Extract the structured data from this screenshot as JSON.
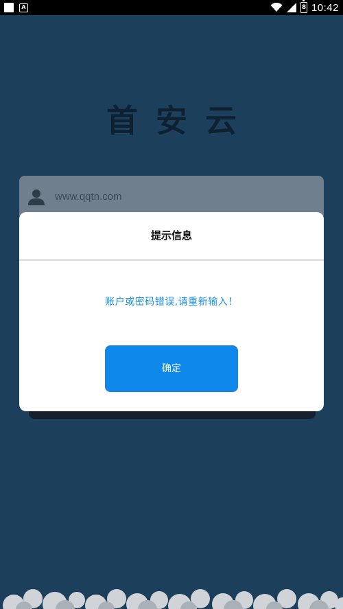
{
  "status_bar": {
    "time": "10:42",
    "battery_label": "8",
    "icons": [
      "square-notification-icon",
      "a-box-icon",
      "wifi-icon",
      "signal-icon",
      "battery-icon"
    ]
  },
  "brand": {
    "title": "首安云"
  },
  "login": {
    "username_placeholder": "www.qqtn.com"
  },
  "dialog": {
    "title": "提示信息",
    "message": "账户或密码错误,请重新输入！",
    "confirm_label": "确定"
  },
  "colors": {
    "background": "#1c3f5c",
    "accent": "#0e88ea",
    "message": "#1a8fe6"
  }
}
